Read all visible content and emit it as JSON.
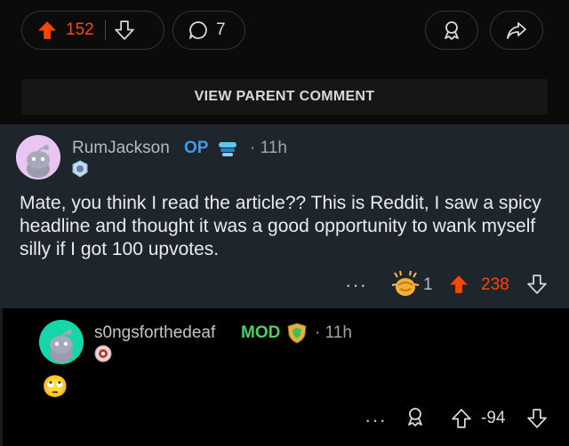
{
  "post_bar": {
    "vote_count": "152",
    "comment_count": "7",
    "colors": {
      "upvote": "#ff4500"
    },
    "icons": [
      "upvote-icon",
      "downvote-icon",
      "comment-bubble-icon",
      "award-icon",
      "share-icon"
    ]
  },
  "view_parent_label": "VIEW PARENT COMMENT",
  "comment": {
    "username": "RumJackson",
    "op_badge": "OP",
    "time": "11h",
    "text": "Mate, you think I read the article?? This is Reddit, I saw a spicy headline and thought it was a good opportunity to wank myself silly if I got 100 upvotes.",
    "award_count": "1",
    "score": "238",
    "colors": {
      "op": "#3b9ce8",
      "score": "#ff4500",
      "highlight_bg": "#1f252c"
    }
  },
  "reply": {
    "username": "s0ngsforthedeaf",
    "mod_badge": "MOD",
    "time": "11h",
    "emoji": "🙄",
    "score": "-94",
    "colors": {
      "mod": "#46d160"
    }
  }
}
